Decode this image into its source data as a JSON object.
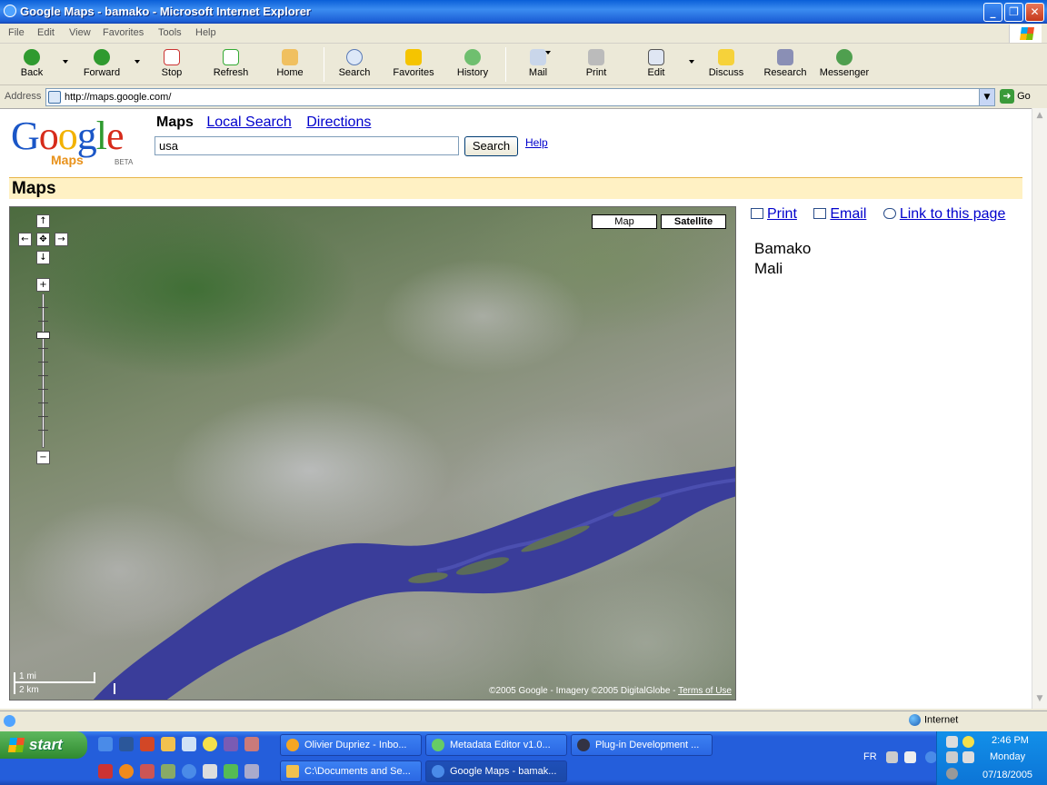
{
  "window": {
    "title": "Google Maps - bamako - Microsoft Internet Explorer"
  },
  "menu": [
    "File",
    "Edit",
    "View",
    "Favorites",
    "Tools",
    "Help"
  ],
  "toolbar": {
    "back": "Back",
    "forward": "Forward",
    "stop": "Stop",
    "refresh": "Refresh",
    "home": "Home",
    "search": "Search",
    "favorites": "Favorites",
    "history": "History",
    "mail": "Mail",
    "print": "Print",
    "edit": "Edit",
    "discuss": "Discuss",
    "research": "Research",
    "messenger": "Messenger"
  },
  "address": {
    "label": "Address",
    "url": "http://maps.google.com/",
    "go": "Go"
  },
  "page": {
    "logo": {
      "maps": "Maps",
      "beta": "BETA"
    },
    "nav": {
      "current": "Maps",
      "local_search": "Local Search",
      "directions": "Directions"
    },
    "search": {
      "value": "usa",
      "button": "Search",
      "help": "Help"
    },
    "section_title": "Maps",
    "map": {
      "type_map": "Map",
      "type_satellite": "Satellite",
      "selected_type": "Satellite",
      "scale_mi": "1 mi",
      "scale_km": "2 km",
      "copyright": "©2005 Google - Imagery ©2005 DigitalGlobe - ",
      "terms": "Terms of Use"
    },
    "side": {
      "print": "Print",
      "email": "Email",
      "link": "Link to this page"
    },
    "place": {
      "city": "Bamako",
      "country": "Mali"
    }
  },
  "status": {
    "zone": "Internet"
  },
  "taskbar": {
    "start": "start",
    "tasks_row1": [
      "Olivier Dupriez - Inbo...",
      "Metadata Editor v1.0...",
      "Plug-in Development ..."
    ],
    "tasks_row2": [
      "C:\\Documents and Se...",
      "Google Maps - bamak..."
    ],
    "lang": "FR",
    "time": "2:46 PM",
    "day": "Monday",
    "date": "07/18/2005"
  }
}
